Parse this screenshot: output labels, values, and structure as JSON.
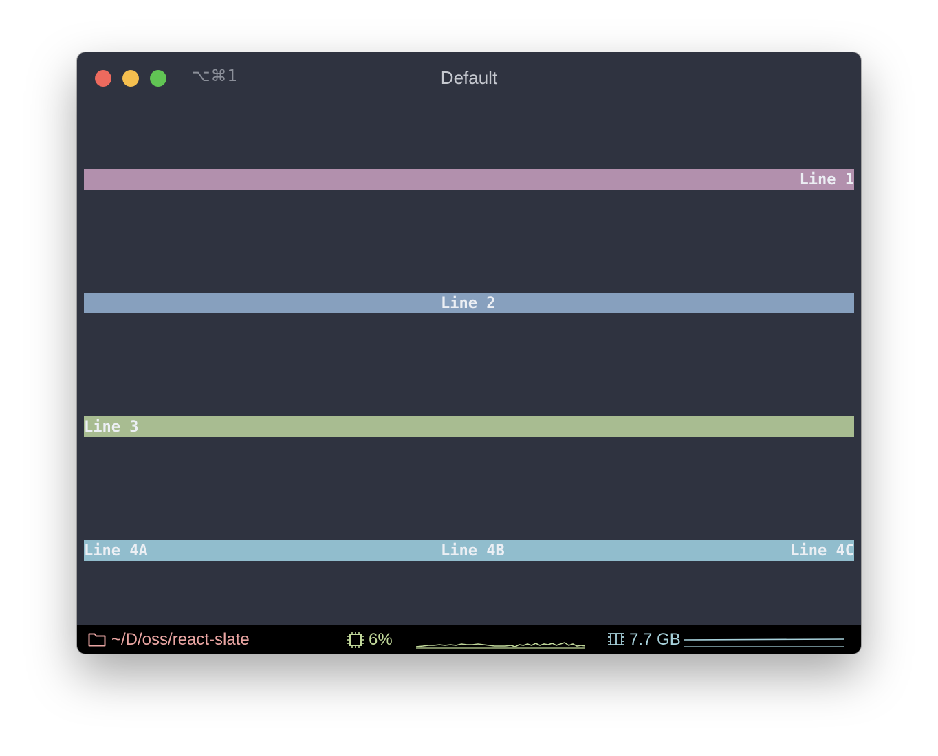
{
  "window": {
    "shortcut": "⌥⌘1",
    "title": "Default"
  },
  "terminal": {
    "lines": [
      {
        "color": "#b290ad",
        "segments": [
          {
            "text": "Line 1",
            "align": "right"
          }
        ]
      },
      {
        "color": "#87a0be",
        "segments": [
          {
            "text": "Line 2",
            "align": "center"
          }
        ]
      },
      {
        "color": "#a8bc91",
        "segments": [
          {
            "text": "Line 3",
            "align": "left"
          }
        ]
      },
      {
        "color": "#91bdcd",
        "segments": [
          {
            "text": "Line 4A",
            "align": "left"
          },
          {
            "text": "Line 4B",
            "align": "center"
          },
          {
            "text": "Line 4C",
            "align": "right"
          }
        ]
      }
    ]
  },
  "statusbar": {
    "path": {
      "icon": "folder-icon",
      "text": "~/D/oss/react-slate",
      "color": "#e9a5a2"
    },
    "cpu": {
      "icon": "cpu-chip-icon",
      "text": "6%",
      "color": "#c1d89a"
    },
    "memory": {
      "icon": "memory-icon",
      "text": "7.7 GB",
      "color": "#a8d2dc"
    }
  }
}
